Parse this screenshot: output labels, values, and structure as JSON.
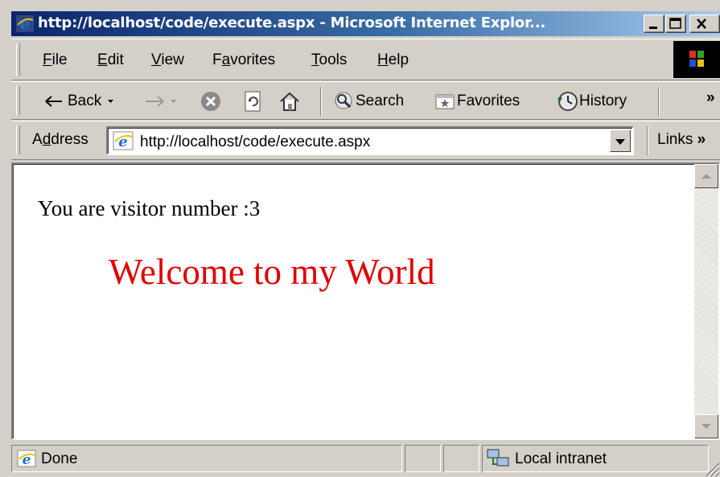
{
  "window": {
    "title": "http://localhost/code/execute.aspx - Microsoft Internet Explor...",
    "minimize_icon": "minimize-icon",
    "maximize_icon": "maximize-icon",
    "close_icon": "close-icon"
  },
  "menu": {
    "items": [
      {
        "accel": "F",
        "rest": "ile"
      },
      {
        "accel": "E",
        "rest": "dit"
      },
      {
        "accel": "V",
        "rest": "iew"
      },
      {
        "pre": "F",
        "accel": "a",
        "rest": "vorites"
      },
      {
        "accel": "T",
        "rest": "ools"
      },
      {
        "accel": "H",
        "rest": "elp"
      }
    ]
  },
  "toolbar": {
    "back": "Back",
    "search": "Search",
    "favorites": "Favorites",
    "history": "History",
    "more": "»"
  },
  "address": {
    "label_pre": "A",
    "label_accel": "d",
    "label_rest": "dress",
    "url": "http://localhost/code/execute.aspx",
    "links": "Links",
    "links_more": "»"
  },
  "page": {
    "visitor_text": "You are visitor number :3",
    "welcome_text": "Welcome to my World",
    "welcome_color": "#e00000"
  },
  "status": {
    "text": "Done",
    "zone": "Local intranet"
  }
}
